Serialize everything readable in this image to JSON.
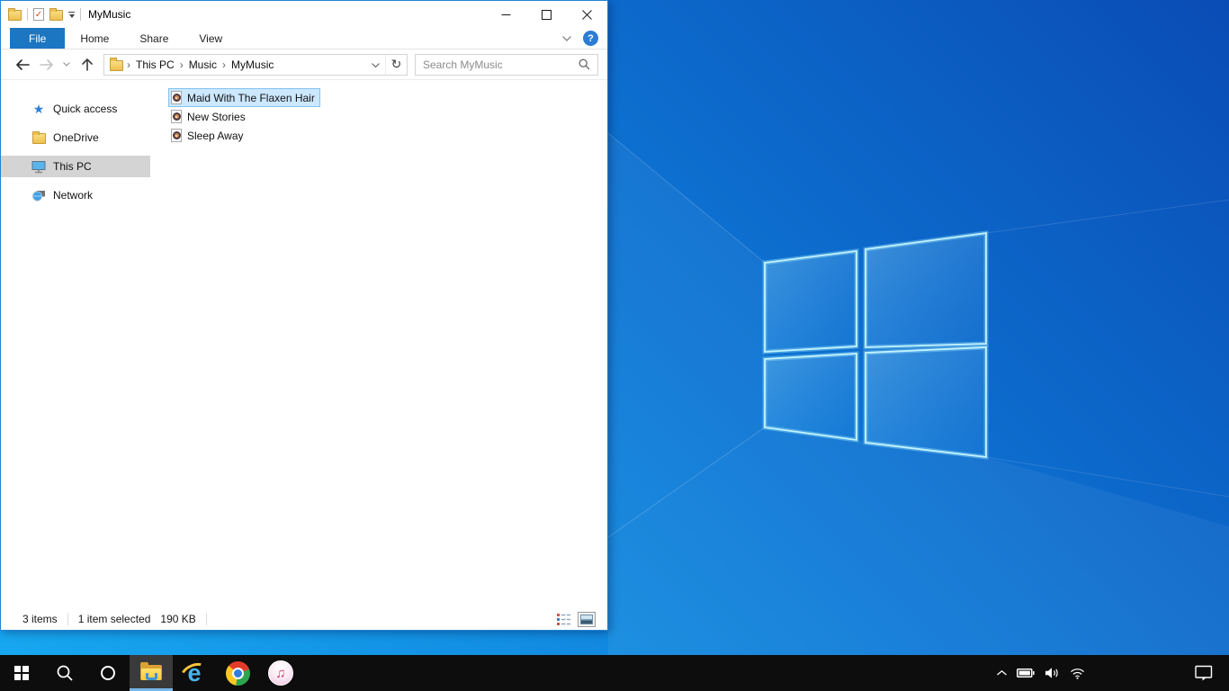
{
  "explorer": {
    "title": "MyMusic",
    "tabs": [
      "File",
      "Home",
      "Share",
      "View"
    ],
    "breadcrumb": [
      "This PC",
      "Music",
      "MyMusic"
    ],
    "search_placeholder": "Search MyMusic",
    "sidebar": [
      {
        "label": "Quick access",
        "icon": "quick-access-star"
      },
      {
        "label": "OneDrive",
        "icon": "folder"
      },
      {
        "label": "This PC",
        "icon": "monitor",
        "selected": true
      },
      {
        "label": "Network",
        "icon": "network-globe"
      }
    ],
    "files": [
      {
        "name": "Maid With The Flaxen Hair",
        "selected": true
      },
      {
        "name": "New Stories",
        "selected": false
      },
      {
        "name": "Sleep Away",
        "selected": false
      }
    ],
    "status": {
      "count": "3 items",
      "selected": "1 item selected",
      "size": "190 KB"
    }
  },
  "icons": {
    "refresh": "↻",
    "help": "?",
    "star": "★",
    "music_note": "♫",
    "ie_letter": "e",
    "crumb_sep": "›"
  },
  "colors": {
    "accent_border": "#2383d6",
    "file_tab": "#1d76c2",
    "selection_bg": "#cce8ff",
    "selection_border": "#84c3f1",
    "sidebar_selected": "#d4d4d4",
    "taskbar": "#0d0d0d",
    "taskbar_active_underline": "#75b6ea",
    "wallpaper_light": "#17a7f0",
    "wallpaper_dark": "#0a4cb5"
  }
}
